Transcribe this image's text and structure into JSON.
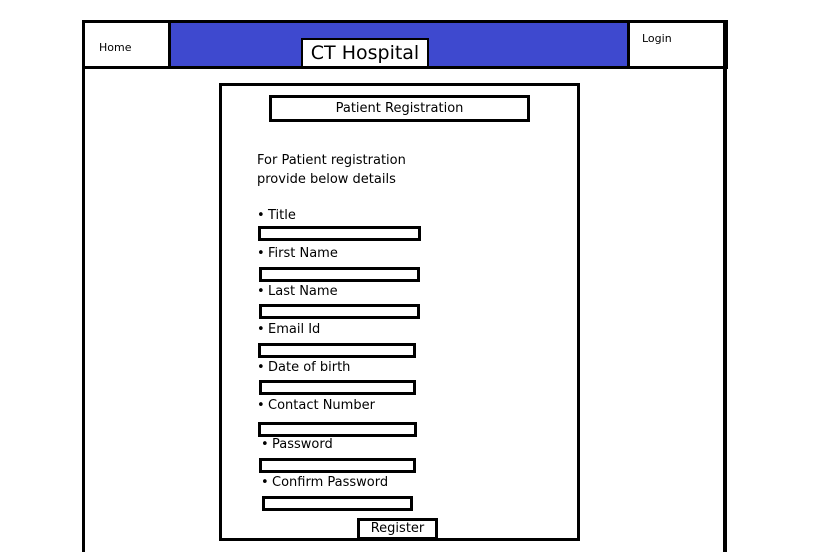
{
  "nav": {
    "home_label": "Home",
    "login_label": "Login"
  },
  "header": {
    "title": "CT Hospital",
    "banner_color": "#3e49cf"
  },
  "form": {
    "title": "Patient Registration",
    "intro_line1": "For Patient registration",
    "intro_line2": "provide below details",
    "fields": [
      {
        "label": "Title"
      },
      {
        "label": "First Name"
      },
      {
        "label": "Last Name"
      },
      {
        "label": "Email Id"
      },
      {
        "label": "Date of birth"
      },
      {
        "label": "Contact Number"
      },
      {
        "label": "Password"
      },
      {
        "label": "Confirm Password"
      }
    ],
    "register_label": "Register"
  }
}
